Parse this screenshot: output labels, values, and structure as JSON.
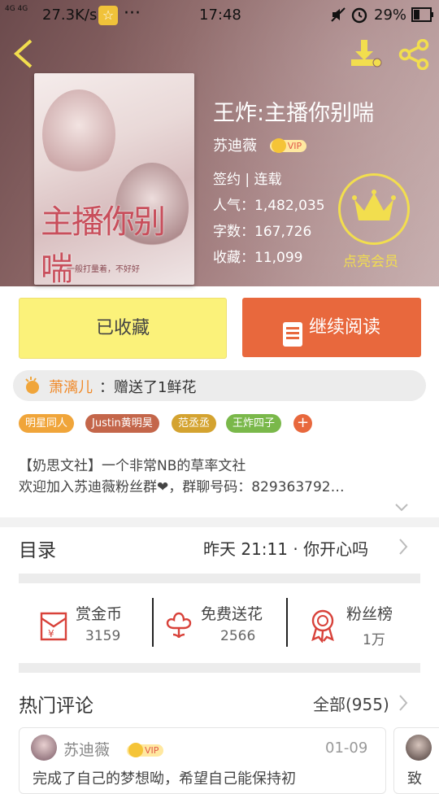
{
  "status_bar": {
    "network": "4G 4G",
    "speed": "27.3K/s",
    "dots": "···",
    "time": "17:48",
    "battery": "29%"
  },
  "header": {
    "back_icon": "chevron-left-icon",
    "download_icon": "download-icon",
    "share_icon": "share-icon"
  },
  "book": {
    "title": "王炸:主播你别喘",
    "author": "苏迪薇",
    "vip_badge": "VIP",
    "status": "签约 | 连载",
    "popularity": "人气：1,482,035",
    "word_count": "字数：167,726",
    "favorites": "收藏：11,099",
    "cover_title": "主播你别喘",
    "cover_subtitle": "一般打量着，不好好"
  },
  "membership": {
    "label": "点亮会员",
    "icon": "crown-icon"
  },
  "actions": {
    "favorited_label": "已收藏",
    "continue_label": "继续阅读"
  },
  "gift": {
    "user": "萧漓儿",
    "text": "：赠送了1鲜花"
  },
  "tags": [
    {
      "label": "明星同人",
      "color": "#f0a53a"
    },
    {
      "label": "Justin黄明昊",
      "color": "#c4664a"
    },
    {
      "label": "范丞丞",
      "color": "#d4a330"
    },
    {
      "label": "王炸四子",
      "color": "#7ab84a"
    }
  ],
  "description": {
    "line1": "【奶思文社】一个非常NB的草率文社",
    "line2": "欢迎加入苏迪薇粉丝群❤，群聊号码：829363792…"
  },
  "toc": {
    "label": "目录",
    "latest": "昨天 21:11 · 你开心吗"
  },
  "stats": [
    {
      "label": "赏金币",
      "value": "3159",
      "icon": "coin-envelope-icon"
    },
    {
      "label": "免费送花",
      "value": "2566",
      "icon": "flower-icon"
    },
    {
      "label": "粉丝榜",
      "value": "1万",
      "icon": "medal-icon"
    }
  ],
  "comments": {
    "header": "热门评论",
    "all_label": "全部(955)",
    "first": {
      "author": "苏迪薇",
      "vip": "VIP",
      "date": "01-09",
      "text": "完成了自己的梦想呦，希望自己能保持初"
    },
    "second_text": "致"
  },
  "colors": {
    "accent_orange": "#e8683d",
    "accent_yellow": "#fbf27a",
    "gold": "#f2de4e"
  }
}
